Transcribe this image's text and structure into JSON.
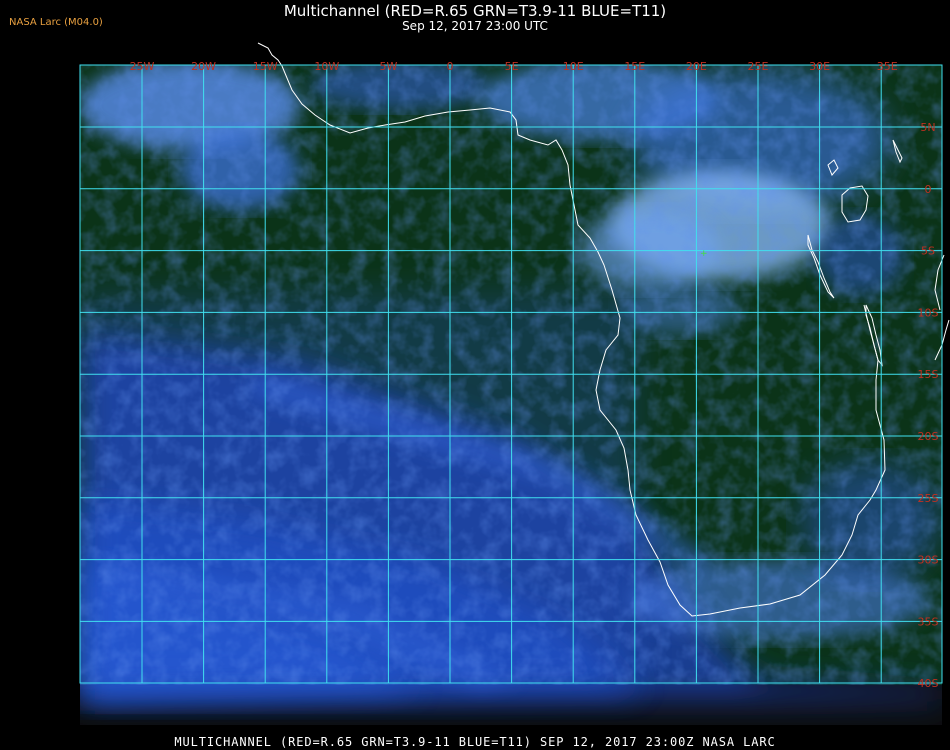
{
  "header": {
    "title": "Multichannel (RED=R.65 GRN=T3.9-11 BLUE=T11)",
    "datetime": "Sep 12, 2017 23:00 UTC"
  },
  "badge": "NASA Larc (M04.0)",
  "footer": "MULTICHANNEL (RED=R.65 GRN=T3.9-11 BLUE=T11) SEP 12, 2017 23:00Z   NASA LARC",
  "map": {
    "lon_labels": [
      "25W",
      "20W",
      "15W",
      "10W",
      "5W",
      "0",
      "5E",
      "10E",
      "15E",
      "20E",
      "25E",
      "30E",
      "35E"
    ],
    "lat_labels": [
      "5N",
      "0",
      "5S",
      "10S",
      "15S",
      "20S",
      "25S",
      "30S",
      "35S",
      "40S"
    ],
    "colors": {
      "grid": "#40e0f0",
      "label": "#c03020",
      "coast": "#ffffff",
      "ocean": "#0a2f14",
      "cloud_low": "#1e48c8",
      "cloud_high": "#a8d0ff"
    }
  }
}
